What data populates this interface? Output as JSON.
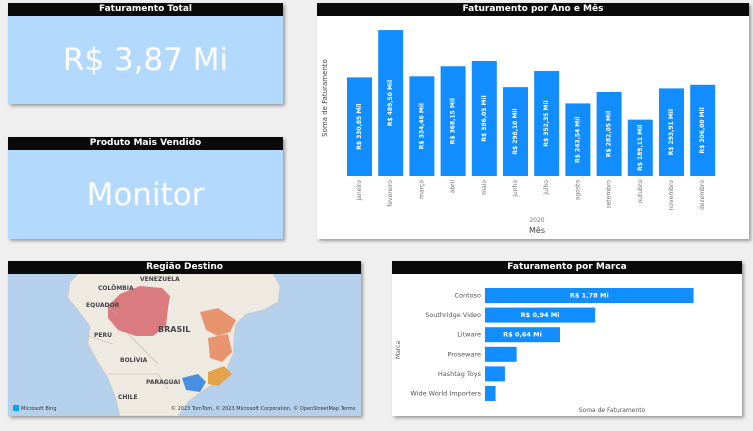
{
  "kpi_total": {
    "title": "Faturamento Total",
    "value": "R$ 3,87 Mi"
  },
  "kpi_produto": {
    "title": "Produto Mais Vendido",
    "value": "Monitor"
  },
  "map": {
    "title": "Região Destino",
    "labels": [
      "COLÔMBIA",
      "VENEZUELA",
      "EQUADOR",
      "PERU",
      "BRASIL",
      "BOLÍVIA",
      "PARAGUAI",
      "CHILE"
    ],
    "attribution": "© 2023 TomTom, © 2023 Microsoft Corporation, © OpenStreetMap Terms",
    "logo_text": "Microsoft Bing",
    "highlight_colors": [
      "#d97b7f",
      "#e8956f",
      "#4a90e2",
      "#e3a34a"
    ]
  },
  "chart_data": [
    {
      "type": "bar",
      "title": "Faturamento por Ano e Mês",
      "categories": [
        "janeiro",
        "fevereiro",
        "março",
        "abril",
        "maio",
        "junho",
        "julho",
        "agosto",
        "setembro",
        "outubro",
        "novembro",
        "dezembro"
      ],
      "values": [
        330.85,
        489.5,
        334.46,
        368.15,
        386.05,
        298.1,
        352.35,
        243.54,
        282.05,
        189.11,
        293.91,
        306.0
      ],
      "data_labels": [
        "R$ 330,85 Mil",
        "R$ 489,50 Mil",
        "R$ 334,46 Mil",
        "R$ 368,15 Mil",
        "R$ 386,05 Mil",
        "R$ 298,10 Mil",
        "R$ 352,35 Mil",
        "R$ 243,54 Mil",
        "R$ 282,05 Mil",
        "R$ 189,11 Mil",
        "R$ 293,91 Mil",
        "R$ 306,00 Mil"
      ],
      "xlabel": "Mês",
      "x_group_label": "2020",
      "ylabel": "Soma de Faturamento",
      "color": "#118dff",
      "ylim": [
        0,
        520
      ]
    },
    {
      "type": "bar",
      "orientation": "horizontal",
      "title": "Faturamento por Marca",
      "categories": [
        "Contoso",
        "Southridge Video",
        "Litware",
        "Proseware",
        "Hashtag Toys",
        "Wide World Importers"
      ],
      "values": [
        1.78,
        0.94,
        0.64,
        0.27,
        0.17,
        0.09
      ],
      "data_labels": [
        "R$ 1,78 Mi",
        "R$ 0,94 Mi",
        "R$ 0,64 Mi",
        "",
        "",
        ""
      ],
      "xlabel": "Soma de Faturamento",
      "ylabel": "Marca",
      "color": "#118dff",
      "xlim": [
        0,
        1.92
      ]
    }
  ]
}
